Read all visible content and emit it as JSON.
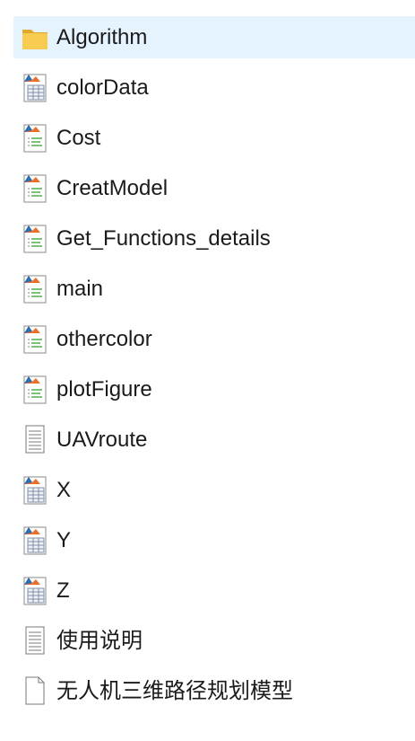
{
  "file_list": {
    "items": [
      {
        "name": "Algorithm",
        "icon": "folder-icon",
        "selected": true
      },
      {
        "name": "colorData",
        "icon": "matlab-data-icon",
        "selected": false
      },
      {
        "name": "Cost",
        "icon": "matlab-script-icon",
        "selected": false
      },
      {
        "name": "CreatModel",
        "icon": "matlab-script-icon",
        "selected": false
      },
      {
        "name": "Get_Functions_details",
        "icon": "matlab-script-icon",
        "selected": false
      },
      {
        "name": "main",
        "icon": "matlab-script-icon",
        "selected": false
      },
      {
        "name": "othercolor",
        "icon": "matlab-script-icon",
        "selected": false
      },
      {
        "name": "plotFigure",
        "icon": "matlab-script-icon",
        "selected": false
      },
      {
        "name": "UAVroute",
        "icon": "text-document-icon",
        "selected": false
      },
      {
        "name": "X",
        "icon": "matlab-data-icon",
        "selected": false
      },
      {
        "name": "Y",
        "icon": "matlab-data-icon",
        "selected": false
      },
      {
        "name": "Z",
        "icon": "matlab-data-icon",
        "selected": false
      },
      {
        "name": "使用说明",
        "icon": "text-document-icon",
        "selected": false
      },
      {
        "name": "无人机三维路径规划模型",
        "icon": "blank-file-icon",
        "selected": false
      }
    ]
  },
  "colors": {
    "selection_background": "#e5f3ff",
    "folder": "#f5c342",
    "matlab_orange": "#e8702a",
    "matlab_blue": "#2d6db3"
  }
}
